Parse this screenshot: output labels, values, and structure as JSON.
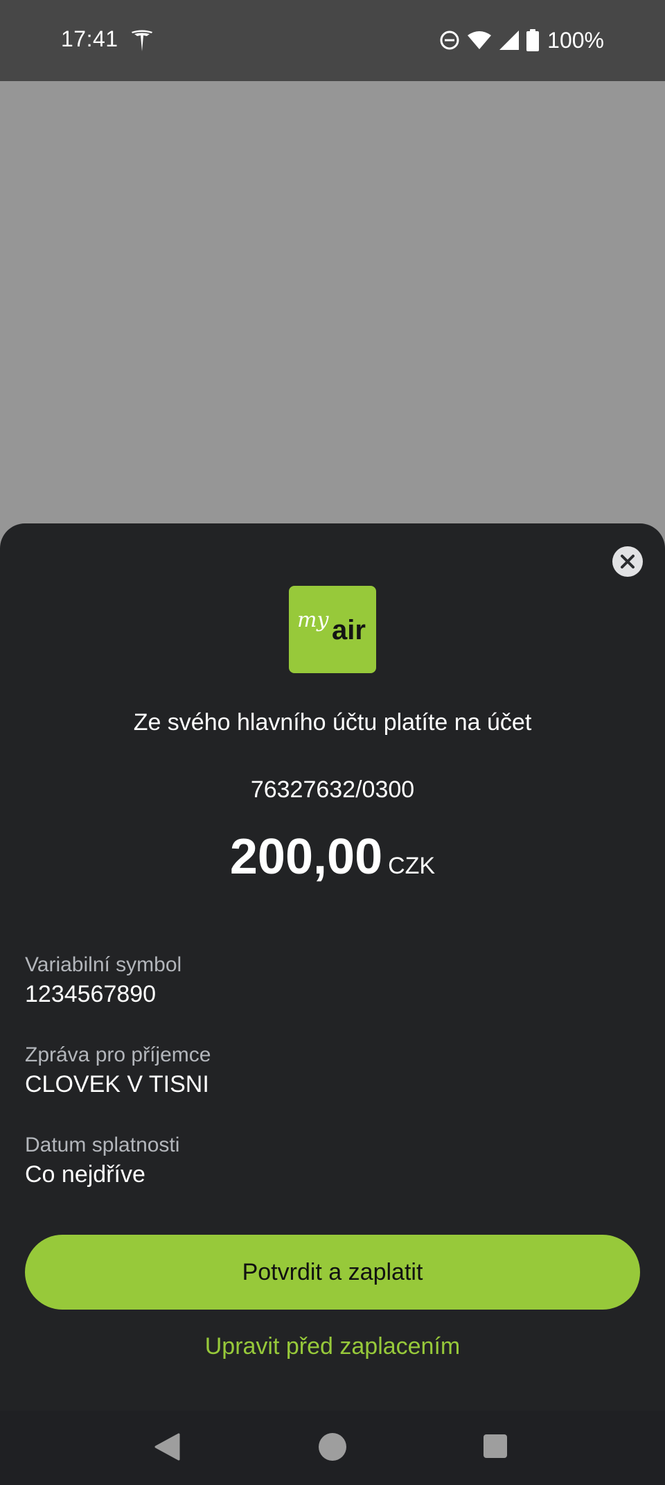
{
  "status_bar": {
    "time": "17:41",
    "battery": "100%",
    "icons": [
      "tesla-icon",
      "do-not-disturb-icon",
      "wifi-icon",
      "signal-icon",
      "battery-icon"
    ]
  },
  "sheet": {
    "close_icon": "close-icon",
    "logo": {
      "my": "my",
      "air": "air"
    },
    "heading": "Ze svého hlavního účtu platíte na účet",
    "account_number": "76327632/0300",
    "amount": {
      "value": "200,00",
      "currency": "CZK"
    },
    "fields": [
      {
        "label": "Variabilní symbol",
        "value": "1234567890"
      },
      {
        "label": "Zpráva pro příjemce",
        "value": "CLOVEK V TISNI"
      },
      {
        "label": "Datum splatnosti",
        "value": "Co nejdříve"
      }
    ],
    "confirm_label": "Potvrdit a zaplatit",
    "edit_label": "Upravit před zaplacením"
  },
  "nav_bar": {
    "icons": [
      "back-icon",
      "home-icon",
      "recents-icon"
    ]
  },
  "colors": {
    "accent": "#97c93a",
    "sheet_bg": "#222325",
    "status_bar_bg": "#474747",
    "backdrop": "#969696"
  }
}
